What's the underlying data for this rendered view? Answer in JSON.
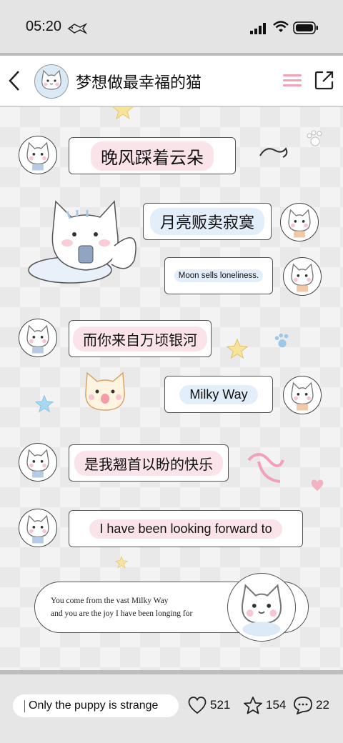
{
  "status_bar": {
    "time": "05:20"
  },
  "header": {
    "title": "梦想做最幸福的猫"
  },
  "messages": [
    {
      "side": "left",
      "text": "晚风踩着云朵"
    },
    {
      "side": "right",
      "text": "月亮贩卖寂寞"
    },
    {
      "side": "right",
      "text": "Moon sells loneliness."
    },
    {
      "side": "left",
      "text": "而你来自万顷银河"
    },
    {
      "side": "right",
      "text": "Milky Way"
    },
    {
      "side": "left",
      "text": "是我翘首以盼的快乐"
    },
    {
      "side": "left",
      "text": "I have been looking forward to"
    }
  ],
  "final_card": {
    "line1": "You come from the vast Milky Way",
    "line2": "and you are the joy I have been longing for"
  },
  "bottom_bar": {
    "comment_text": "Only the puppy is strange",
    "likes": "521",
    "favorites": "154",
    "comments": "22"
  },
  "colors": {
    "accent_pink": "#f4a6b8",
    "bubble_pink": "#fbe3ea",
    "bubble_blue": "#e3eefb"
  }
}
